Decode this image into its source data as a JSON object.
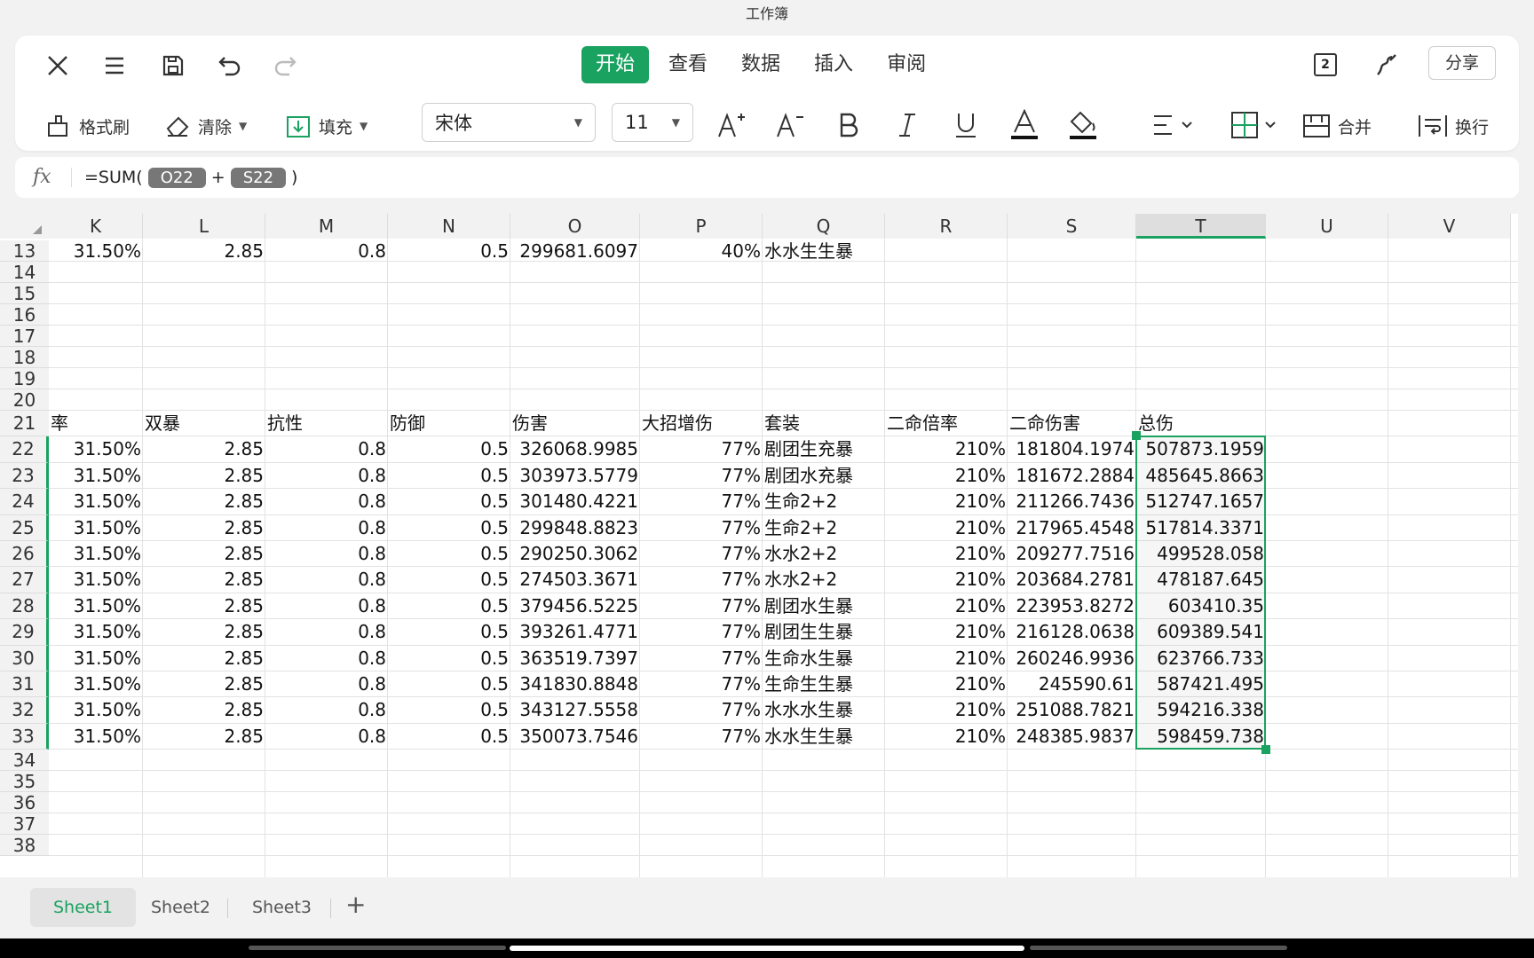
{
  "window": {
    "title": "工作簿"
  },
  "toolbar": {
    "icons": [
      "close-icon",
      "menu-icon",
      "save-icon",
      "undo-icon",
      "redo-icon",
      "pages-icon",
      "pen-icon"
    ],
    "pages_badge": "2",
    "tabs": [
      {
        "label": "开始",
        "active": true
      },
      {
        "label": "查看",
        "active": false
      },
      {
        "label": "数据",
        "active": false
      },
      {
        "label": "插入",
        "active": false
      },
      {
        "label": "审阅",
        "active": false
      }
    ],
    "share_label": "分享",
    "format_painter_label": "格式刷",
    "clear_label": "清除",
    "fill_label": "填充",
    "font_name": "宋体",
    "font_size": "11",
    "merge_label": "合并",
    "wrap_label": "换行",
    "accent_color": "#1aa260"
  },
  "formula_bar": {
    "fx_label": "fx",
    "prefix": "=SUM(",
    "ref1": "O22",
    "op": "+",
    "ref2": "S22",
    "suffix": ")"
  },
  "grid": {
    "columns": [
      "K",
      "L",
      "M",
      "N",
      "O",
      "P",
      "Q",
      "R",
      "S",
      "T",
      "U",
      "V"
    ],
    "selected_column": "T",
    "row_numbers": [
      "13",
      "14",
      "15",
      "16",
      "17",
      "18",
      "19",
      "20",
      "21",
      "22",
      "23",
      "24",
      "25",
      "26",
      "27",
      "28",
      "29",
      "30",
      "31",
      "32",
      "33",
      "34",
      "35",
      "36",
      "37",
      "38"
    ],
    "row13": [
      "31.50%",
      "2.85",
      "0.8",
      "0.5",
      "299681.6097",
      "40%",
      "水水生生暴",
      "",
      "",
      ""
    ],
    "header_row21": [
      "率",
      "双暴",
      "抗性",
      "防御",
      "伤害",
      "大招增伤",
      "套装",
      "二命倍率",
      "二命伤害",
      "总伤"
    ],
    "data_rows": [
      [
        "31.50%",
        "2.85",
        "0.8",
        "0.5",
        "326068.9985",
        "77%",
        "剧团生充暴",
        "210%",
        "181804.1974",
        "507873.1959"
      ],
      [
        "31.50%",
        "2.85",
        "0.8",
        "0.5",
        "303973.5779",
        "77%",
        "剧团水充暴",
        "210%",
        "181672.2884",
        "485645.8663"
      ],
      [
        "31.50%",
        "2.85",
        "0.8",
        "0.5",
        "301480.4221",
        "77%",
        "生命2+2",
        "210%",
        "211266.7436",
        "512747.1657"
      ],
      [
        "31.50%",
        "2.85",
        "0.8",
        "0.5",
        "299848.8823",
        "77%",
        "生命2+2",
        "210%",
        "217965.4548",
        "517814.3371"
      ],
      [
        "31.50%",
        "2.85",
        "0.8",
        "0.5",
        "290250.3062",
        "77%",
        "水水2+2",
        "210%",
        "209277.7516",
        "499528.058"
      ],
      [
        "31.50%",
        "2.85",
        "0.8",
        "0.5",
        "274503.3671",
        "77%",
        "水水2+2",
        "210%",
        "203684.2781",
        "478187.645"
      ],
      [
        "31.50%",
        "2.85",
        "0.8",
        "0.5",
        "379456.5225",
        "77%",
        "剧团水生暴",
        "210%",
        "223953.8272",
        "603410.35"
      ],
      [
        "31.50%",
        "2.85",
        "0.8",
        "0.5",
        "393261.4771",
        "77%",
        "剧团生生暴",
        "210%",
        "216128.0638",
        "609389.541"
      ],
      [
        "31.50%",
        "2.85",
        "0.8",
        "0.5",
        "363519.7397",
        "77%",
        "生命水生暴",
        "210%",
        "260246.9936",
        "623766.733"
      ],
      [
        "31.50%",
        "2.85",
        "0.8",
        "0.5",
        "341830.8848",
        "77%",
        "生命生生暴",
        "210%",
        "245590.61",
        "587421.495"
      ],
      [
        "31.50%",
        "2.85",
        "0.8",
        "0.5",
        "343127.5558",
        "77%",
        "水水水生暴",
        "210%",
        "251088.7821",
        "594216.338"
      ],
      [
        "31.50%",
        "2.85",
        "0.8",
        "0.5",
        "350073.7546",
        "77%",
        "水水生生暴",
        "210%",
        "248385.9837",
        "598459.738"
      ]
    ]
  },
  "sheets": [
    {
      "label": "Sheet1",
      "active": true
    },
    {
      "label": "Sheet2",
      "active": false
    },
    {
      "label": "Sheet3",
      "active": false
    }
  ],
  "add_sheet_label": "+"
}
